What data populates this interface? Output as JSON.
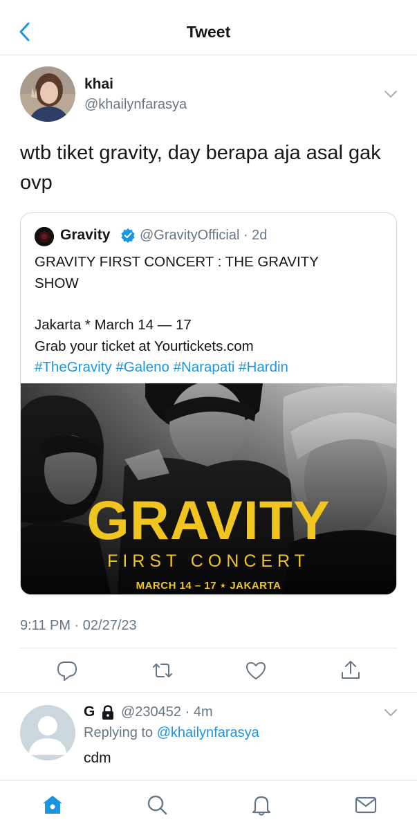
{
  "header": {
    "title": "Tweet",
    "back_icon": "chevron-left-icon"
  },
  "tweet": {
    "author_name": "khai",
    "author_handle": "@khailynfarasya",
    "text": "wtb tiket gravity, day berapa aja asal gak ovp",
    "timestamp": "9:11 PM · 02/27/23",
    "quoted": {
      "name": "Gravity",
      "handle_time": "@GravityOfficial · 2d",
      "lines": [
        "GRAVITY FIRST CONCERT : THE GRAVITY",
        "SHOW",
        "",
        "Jakarta * March 14 — 17",
        "Grab your ticket at Yourtickets.com"
      ],
      "hashtags": [
        "#TheGravity",
        "#Galeno",
        "#Narapati",
        "#Hardin"
      ],
      "image": {
        "title": "GRAVITY",
        "subtitle": "FIRST CONCERT",
        "date": "MARCH 14 – 17 ⋆ JAKARTA"
      }
    }
  },
  "actions": [
    "reply-icon",
    "retweet-icon",
    "like-icon",
    "share-icon"
  ],
  "reply": {
    "name": "G",
    "handle_time": "@230452 · 4m",
    "replying_prefix": "Replying to",
    "replying_to": "@khailynfarasya",
    "text": "cdm"
  },
  "tabbar": [
    "home-icon",
    "search-icon",
    "notifications-icon",
    "messages-icon"
  ],
  "colors": {
    "accent": "#1b95e0",
    "secondary_text": "#657786",
    "poster_yellow": "#f0c51f"
  }
}
